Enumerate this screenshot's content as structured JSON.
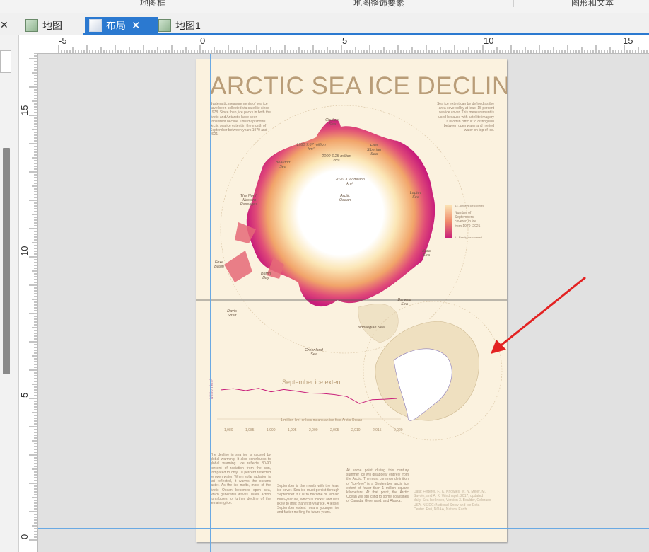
{
  "ribbon_groups": [
    "地图框",
    "地图整饰要素",
    "图形和文本"
  ],
  "tabs": [
    {
      "label": "地图",
      "active": false
    },
    {
      "label": "布局",
      "active": true
    },
    {
      "label": "地图1",
      "active": false
    }
  ],
  "ruler": {
    "h_labels": [
      "-5",
      "0",
      "5",
      "10",
      "15"
    ],
    "v_labels": [
      "15",
      "10",
      "5",
      "0"
    ]
  },
  "layout": {
    "title": "ARCTIC SEA ICE DECLINE",
    "intro_left": "Systematic measurements of sea ice have been collected via satellite since 1978. Since then, ice packs in both the Arctic and Antarctic have seen consistent decline. This map shows Arctic sea ice extent in the month of September between years 1979 and 2021.",
    "intro_right": "Sea ice extent can be defined as the area covered by at least 15 percent sea ice cover. This measurement is used because with satellite imagery it is often difficult to distinguish between open water and melted water on top of ice.",
    "labels": {
      "chukchi": "Chukchi Sea",
      "year1980": "1980 7.67 million km²",
      "year2000": "2000 6.25 million km²",
      "year2020": "2020 3.92 million km²",
      "east_siberian": "East Siberian Sea",
      "beaufort": "Beaufort Sea",
      "arctic": "Arctic Ocean",
      "laptev": "Laptev Sea",
      "nwp": "The North Western Passages",
      "kara": "Kara Sea",
      "foxe": "Foxe Basin",
      "baffin": "Baffin Bay",
      "davis": "Davis Strait",
      "barents": "Barents Sea",
      "norwegian": "Norwegian Sea",
      "greenland": "Greenland Sea"
    },
    "legend": {
      "top": "43 - Always ice covered",
      "caption": "Number of Septembers covered in ice from 1979–2021",
      "bottom": "1 - Rarely ice covered"
    },
    "chart_title": "September ice extent",
    "chart_ylabel": "Million km²",
    "chart_note": "1 million km² or less means an ice-free Arctic Ocean",
    "chart_xticks": [
      "1,980",
      "1,985",
      "1,990",
      "1,995",
      "2,000",
      "2,005",
      "2,010",
      "2,015",
      "2,020"
    ],
    "body1": "The decline in sea ice is caused by global warming. It also contributes to global warming. Ice reflects 80-90 percent of radiation from the sun, compared to only 10 percent reflected by open water. When solar radiation is not reflected, it warms the oceans faster. As the ice melts, more of the Arctic Ocean becomes open sea, which generates waves. Wave action contributes to further decline of the remaining ice.",
    "body2": "September is the month with the least ice cover. Sea ice must persist through September if it is to become or remain multi-year ice, which is thicker and less likely to melt than first-year ice. A lesser September extent means younger ice and faster melting for future years.",
    "body3": "At some point during this century summer ice will disappear entirely from the Arctic. The most common definition of \"ice-free\" is a September arctic ice extent of fewer than 1 million square kilometers. At that point, the Arctic Ocean will still cling to some coastlines of Canada, Greenland, and Alaska.",
    "credits": "Data: Fetterer, F., K. Knowles, W. N. Meier, M. Savoie, and A. K. Windnagel. 2017, updated daily. Sea Ice Index, Version 3. Boulder, Colorado USA. NSIDC: National Snow and Ice Data Center. Esri, NOAA, Natural Earth."
  },
  "chart_data": {
    "type": "line",
    "title": "September ice extent",
    "ylabel": "Million km²",
    "x": [
      1979,
      1982,
      1985,
      1988,
      1991,
      1994,
      1997,
      2000,
      2003,
      2006,
      2009,
      2012,
      2015,
      2018,
      2021
    ],
    "values": [
      7.1,
      7.4,
      6.9,
      7.5,
      6.6,
      7.2,
      6.8,
      6.3,
      6.2,
      5.9,
      5.4,
      3.6,
      4.6,
      4.7,
      4.9
    ],
    "ylim": [
      0,
      8
    ],
    "xlim": [
      1979,
      2021
    ]
  },
  "colors": {
    "ice_dark": "#c81d7a",
    "ice_light": "#fbe6b6",
    "selection_tab": "#2b79d0",
    "guide": "#6aa9e3",
    "arrow": "#e32222"
  }
}
